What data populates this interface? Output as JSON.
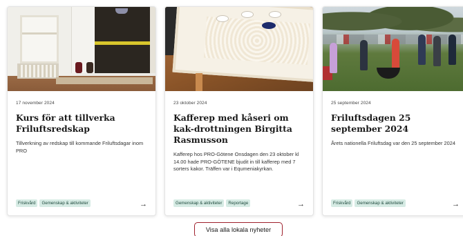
{
  "news_cards": [
    {
      "date": "17 november 2024",
      "title": "Kurs för att tillverka Friluftsredskap",
      "description": "Tillverkning av redskap till kommande Friluftsdagar inom PRO",
      "tags": [
        "Friskvård",
        "Gemenskap & aktiviteter"
      ],
      "arrow": "→",
      "image_icon": "workshop-photo"
    },
    {
      "date": "23 oktober 2024",
      "title": "Kafferep med kåseri om kak-drottningen Birgitta Rasmusson",
      "description": "Kafferep hos PRO-Götene Onsdagen den 23 oktober kl 14.00 hade  PRO-GÖTENE bjudit in till kafferep med 7 sorters kakor. Träffen var i Equmeniakyrkan.",
      "tags": [
        "Gemenskap & aktiviteter",
        "Reportage"
      ],
      "arrow": "→",
      "image_icon": "coffee-table-photo"
    },
    {
      "date": "25 september 2024",
      "title": "Friluftsdagen 25 september 2024",
      "description": "Årets nationella Friluftsdag var den 25 september 2024",
      "tags": [
        "Friskvård",
        "Gemenskap & aktiviteter"
      ],
      "arrow": "→",
      "image_icon": "outdoor-gathering-photo"
    }
  ],
  "show_all_button": {
    "label": "Visa alla lokala nyheter"
  },
  "colors": {
    "tag_bg": "#d6ebe4",
    "tag_text": "#1e4a3d",
    "button_border": "#9e1f2b"
  }
}
